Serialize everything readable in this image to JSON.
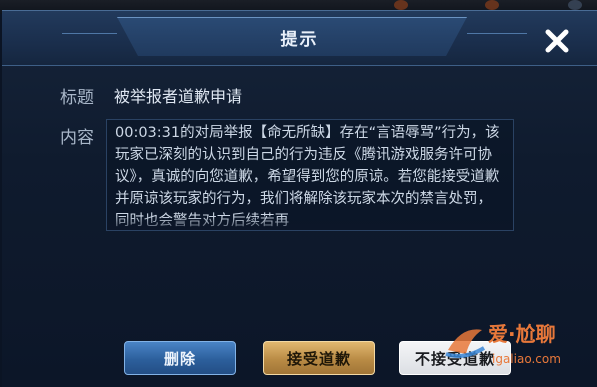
{
  "dialog": {
    "title": "提示",
    "close_icon": "close-icon"
  },
  "fields": {
    "title_label": "标题",
    "title_value": "被举报者道歉申请",
    "content_label": "内容",
    "content_text": "00:03:31的对局举报【命无所缺】存在“言语辱骂”行为，该玩家已深刻的认识到自己的行为违反《腾讯游戏服务许可协议》，真诚的向您道歉，希望得到您的原谅。若您能接受道歉并原谅该玩家的行为，我们将解除该玩家本次的禁言处罚，同时也会警告对方后续若再"
  },
  "buttons": {
    "delete": "删除",
    "accept": "接受道歉",
    "decline": "不接受道歉"
  },
  "watermark": {
    "brand": "爱·尬聊",
    "url": "igaliao.com"
  }
}
